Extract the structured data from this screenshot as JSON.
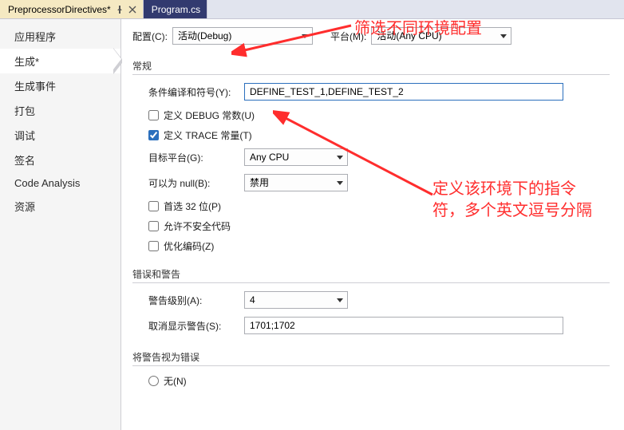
{
  "tabs": [
    {
      "label": "PreprocessorDirectives*",
      "active": true
    },
    {
      "label": "Program.cs",
      "active": false
    }
  ],
  "sidebar": {
    "items": [
      {
        "label": "应用程序"
      },
      {
        "label": "生成*"
      },
      {
        "label": "生成事件"
      },
      {
        "label": "打包"
      },
      {
        "label": "调试"
      },
      {
        "label": "签名"
      },
      {
        "label": "Code Analysis"
      },
      {
        "label": "资源"
      }
    ],
    "active_index": 1
  },
  "toprow": {
    "config_label": "配置(C):",
    "config_value": "活动(Debug)",
    "platform_label": "平台(M):",
    "platform_value": "活动(Any CPU)"
  },
  "sections": {
    "general": {
      "title": "常规",
      "symbols_label": "条件编译和符号(Y):",
      "symbols_value": "DEFINE_TEST_1,DEFINE_TEST_2",
      "debug_const_label": "定义 DEBUG 常数(U)",
      "debug_const_checked": false,
      "trace_const_label": "定义 TRACE 常量(T)",
      "trace_const_checked": true,
      "target_platform_label": "目标平台(G):",
      "target_platform_value": "Any CPU",
      "nullable_label": "可以为 null(B):",
      "nullable_value": "禁用",
      "prefer32_label": "首选 32 位(P)",
      "prefer32_checked": false,
      "unsafe_label": "允许不安全代码",
      "unsafe_checked": false,
      "optimize_label": "优化编码(Z)",
      "optimize_checked": false
    },
    "warnings": {
      "title": "错误和警告",
      "level_label": "警告级别(A):",
      "level_value": "4",
      "suppress_label": "取消显示警告(S):",
      "suppress_value": "1701;1702"
    },
    "treat_as_error": {
      "title": "将警告视为错误",
      "none_label": "无(N)"
    }
  },
  "annotations": {
    "top": "筛选不同环境配置",
    "right": "定义该环境下的指令符，多个英文逗号分隔"
  },
  "colors": {
    "annotation": "#ff2d2d",
    "tab_active_bg": "#f5e9c2",
    "tab_inactive_bg": "#323a6f",
    "input_focus_border": "#2b6fbd"
  }
}
